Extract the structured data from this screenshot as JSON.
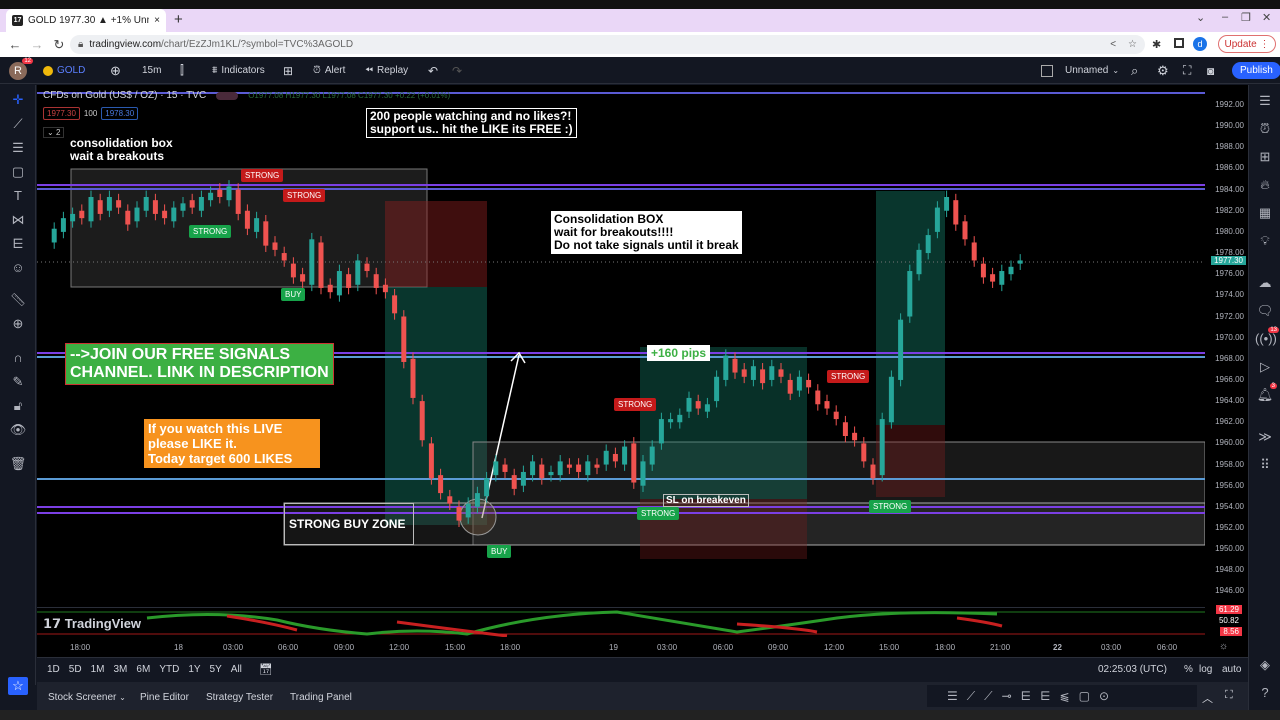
{
  "browser": {
    "tab_title": "GOLD 1977.30 ▲ +1% Unn",
    "tab_close": "×",
    "new_tab": "+",
    "url_host": "tradingview.com",
    "url_path": "/chart/EzZJm1KL/?symbol=TVC%3AGOLD",
    "update_label": "Update",
    "profile_initial": "d",
    "window_controls": [
      "⌄",
      "–",
      "❐",
      "✕"
    ]
  },
  "header": {
    "avatar_initial": "R",
    "avatar_badge": "12",
    "symbol": "GOLD",
    "interval": "15m",
    "indicators_label": "Indicators",
    "alert_label": "Alert",
    "replay_label": "Replay",
    "layout_name": "Unnamed",
    "publish_label": "Publish"
  },
  "legend": {
    "title": "CFDs on Gold (US$ / OZ) · 15 · TVC",
    "ohlc": "O1977.08 H1977.30 L1977.08 C1977.30 +0.22 (+0.01%)",
    "bid": "1977.30",
    "spread": "100",
    "ask": "1978.30",
    "collapse_count": "2"
  },
  "price_axis": {
    "ticks": [
      "1992.00",
      "1990.00",
      "1988.00",
      "1986.00",
      "1984.00",
      "1982.00",
      "1980.00",
      "1978.00",
      "1976.00",
      "1974.00",
      "1972.00",
      "1970.00",
      "1968.00",
      "1966.00",
      "1964.00",
      "1962.00",
      "1960.00",
      "1958.00",
      "1956.00",
      "1954.00",
      "1952.00",
      "1950.00",
      "1948.00",
      "1946.00"
    ],
    "current_price": "1977.30",
    "current_color": "#26a69a",
    "indicator_values": [
      "61.29",
      "50.82",
      "8.56"
    ]
  },
  "time_axis": {
    "ticks": [
      "18:00",
      "18",
      "03:00",
      "06:00",
      "09:00",
      "12:00",
      "15:00",
      "18:00",
      "19",
      "03:00",
      "06:00",
      "09:00",
      "12:00",
      "15:00",
      "18:00",
      "21:00",
      "22",
      "03:00",
      "06:00"
    ]
  },
  "annotations": {
    "consolidation_box": [
      "consolidation box",
      "wait a breakouts"
    ],
    "likes_banner": [
      "200 people watching and no likes?!",
      "support us.. hit the LIKE its FREE :)"
    ],
    "consolidation_note": [
      "Consolidation BOX",
      "wait for breakouts!!!!",
      "Do not take signals until it break"
    ],
    "join_banner": [
      "-->JOIN OUR FREE SIGNALS",
      "CHANNEL. LINK IN DESCRIPTION"
    ],
    "like_live": [
      "If you watch this LIVE",
      "please LIKE it.",
      "Today target 600 LIKES"
    ],
    "pips": "+160 pips",
    "buy_zone": "STRONG BUY ZONE",
    "sl_note": "SL on breakeven",
    "signals": [
      {
        "label": "STRONG",
        "type": "sell"
      },
      {
        "label": "STRONG",
        "type": "sell"
      },
      {
        "label": "STRONG",
        "type": "buy"
      },
      {
        "label": "BUY",
        "type": "buy"
      },
      {
        "label": "STRONG",
        "type": "sell"
      },
      {
        "label": "STRONG",
        "type": "sell"
      },
      {
        "label": "STRONG",
        "type": "buy"
      },
      {
        "label": "BUY",
        "type": "buy"
      },
      {
        "label": "STRONG",
        "type": "buy"
      }
    ]
  },
  "watermark": "TradingView",
  "range_bar": {
    "ranges": [
      "1D",
      "5D",
      "1M",
      "3M",
      "6M",
      "YTD",
      "1Y",
      "5Y",
      "All"
    ],
    "clock": "02:25:03 (UTC)",
    "percent": "%",
    "log": "log",
    "auto": "auto"
  },
  "bottom_tabs": [
    "Stock Screener",
    "Pine Editor",
    "Strategy Tester",
    "Trading Panel"
  ],
  "right_badges": {
    "alerts_sidebar": "13",
    "notifications": "3"
  },
  "colors": {
    "up": "#26a69a",
    "down": "#ef5350",
    "accent": "#2962ff",
    "level_purple": "#7b3fe4",
    "level_blue": "#5b9bd5"
  }
}
